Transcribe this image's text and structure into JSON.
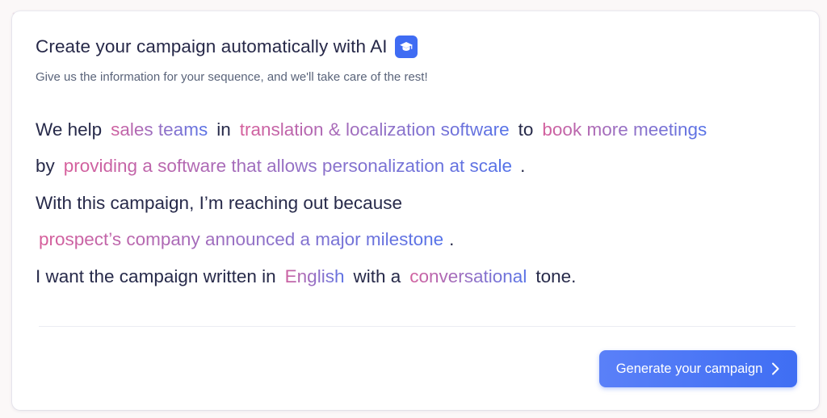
{
  "header": {
    "title": "Create your campaign automatically with AI",
    "subtitle": "Give us the information for your sequence, and we'll take care of the rest!",
    "badge_icon": "graduation-cap-icon"
  },
  "sentence": {
    "line1": {
      "t1": "We help",
      "audience": "sales teams",
      "t2": "in",
      "industry": "translation & localization software",
      "t3": "to",
      "goal": "book more meetings"
    },
    "line2": {
      "t1": "by",
      "method": "providing a software that allows personalization at scale",
      "t2": "."
    },
    "line3": {
      "t1": "With this campaign, I’m reaching out because"
    },
    "line4": {
      "reason": "prospect’s company announced a major milestone",
      "t1": "."
    },
    "line5": {
      "t1": "I want the campaign written in",
      "language": "English",
      "t2": "with a",
      "tone": "conversational",
      "t3": "tone."
    }
  },
  "footer": {
    "generate_label": "Generate your campaign",
    "generate_icon": "chevron-right-icon"
  },
  "colors": {
    "accent_blue": "#3f6ef3",
    "field_gradient_start": "#d85e9a",
    "field_gradient_end": "#5272ea",
    "text_dark": "#272a4a",
    "text_muted": "#5a647a"
  }
}
